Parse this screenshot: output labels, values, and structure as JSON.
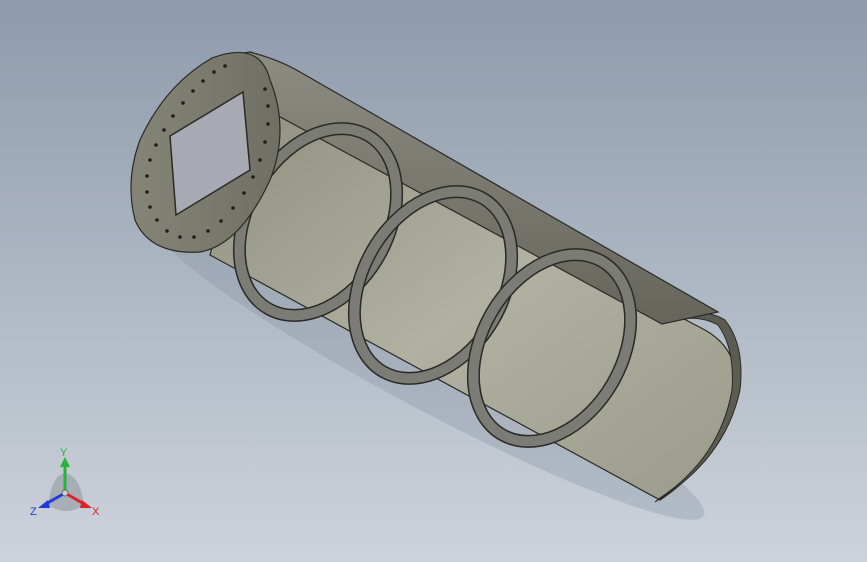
{
  "viewport": {
    "model_name": "half-cylinder-shell-with-ring-stiffeners-and-flanged-end-plate"
  },
  "triad": {
    "x_label": "X",
    "y_label": "Y",
    "z_label": "Z",
    "x_color": "#e0202a",
    "y_color": "#27b43a",
    "z_color": "#2438e0"
  },
  "colors": {
    "shell_face": "#a8a998",
    "shell_dark": "#707062",
    "edge": "#2a2a26",
    "ring": "#7c7c76"
  }
}
